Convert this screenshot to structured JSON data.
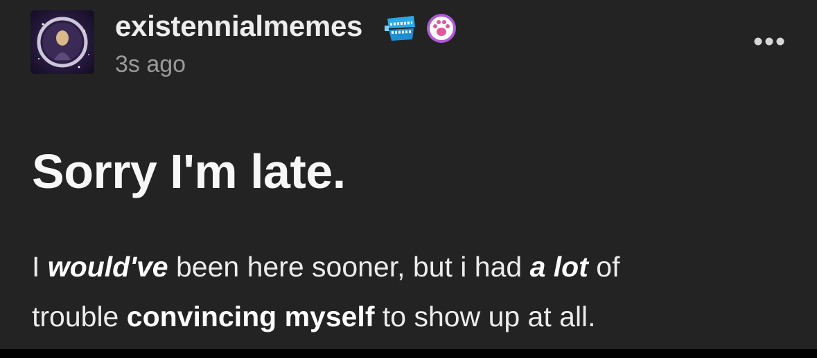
{
  "post": {
    "author": {
      "username": "existennialmemes",
      "badges": [
        {
          "name": "teeth-badge-icon",
          "color": "#2aa9e8"
        },
        {
          "name": "paw-badge-icon",
          "color": "#b05ad6"
        }
      ]
    },
    "timestamp": "3s ago",
    "more_icon": "ellipsis-icon",
    "title": "Sorry I'm late.",
    "body": {
      "line1": {
        "t1": "I ",
        "t2": "would've",
        "t3": " been here sooner, but i had ",
        "t4": "a lot",
        "t5": " of"
      },
      "line2": {
        "t1": "trouble ",
        "t2": "convincing myself",
        "t3": " to show up at all."
      }
    }
  },
  "colors": {
    "background": "#232323",
    "username": "#ededed",
    "timestamp": "#9a9a9a",
    "text": "#ececec"
  }
}
